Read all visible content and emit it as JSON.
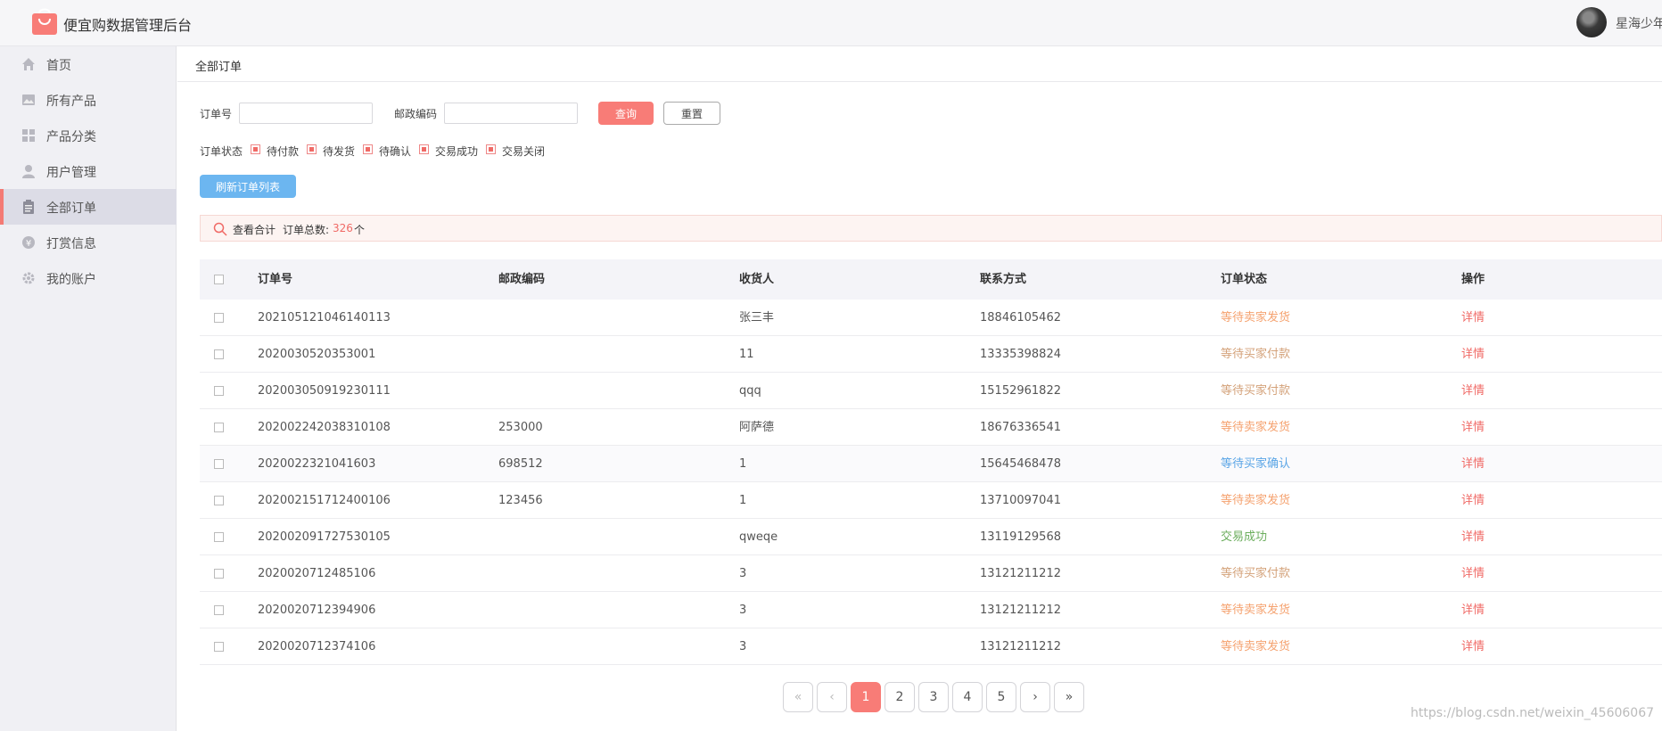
{
  "header": {
    "app_title": "便宜购数据管理后台",
    "user_name": "星海少年"
  },
  "sidebar": {
    "items": [
      {
        "label": "首页",
        "icon": "home-icon"
      },
      {
        "label": "所有产品",
        "icon": "image-icon"
      },
      {
        "label": "产品分类",
        "icon": "grid-icon"
      },
      {
        "label": "用户管理",
        "icon": "user-icon"
      },
      {
        "label": "全部订单",
        "icon": "clipboard-icon",
        "active": true
      },
      {
        "label": "打赏信息",
        "icon": "coin-icon"
      },
      {
        "label": "我的账户",
        "icon": "gear-icon"
      }
    ]
  },
  "breadcrumb": "全部订单",
  "filters": {
    "order_no_label": "订单号",
    "order_no_value": "",
    "postal_label": "邮政编码",
    "postal_value": "",
    "query_label": "查询",
    "reset_label": "重置",
    "status_label": "订单状态",
    "status_options": [
      "待付款",
      "待发货",
      "待确认",
      "交易成功",
      "交易关闭"
    ],
    "refresh_label": "刷新订单列表"
  },
  "summary": {
    "title": "查看合计",
    "total_label": "订单总数:",
    "total_count": "326",
    "unit": "个"
  },
  "table": {
    "headers": [
      "订单号",
      "邮政编码",
      "收货人",
      "联系方式",
      "订单状态",
      "操作"
    ],
    "rows": [
      {
        "order_no": "202105121046140113",
        "postal": "",
        "receiver": "张三丰",
        "phone": "18846105462",
        "status": "等待卖家发货",
        "action": "详情"
      },
      {
        "order_no": "2020030520353001",
        "postal": "",
        "receiver": "11",
        "phone": "13335398824",
        "status": "等待买家付款",
        "action": "详情"
      },
      {
        "order_no": "202003050919230111",
        "postal": "",
        "receiver": "qqq",
        "phone": "15152961822",
        "status": "等待买家付款",
        "action": "详情"
      },
      {
        "order_no": "202002242038310108",
        "postal": "253000",
        "receiver": "阿萨德",
        "phone": "18676336541",
        "status": "等待卖家发货",
        "action": "详情"
      },
      {
        "order_no": "2020022321041603",
        "postal": "698512",
        "receiver": "1",
        "phone": "15645468478",
        "status": "等待买家确认",
        "action": "详情"
      },
      {
        "order_no": "202002151712400106",
        "postal": "123456",
        "receiver": "1",
        "phone": "13710097041",
        "status": "等待卖家发货",
        "action": "详情"
      },
      {
        "order_no": "202002091727530105",
        "postal": "",
        "receiver": "qweqe",
        "phone": "13119129568",
        "status": "交易成功",
        "action": "详情"
      },
      {
        "order_no": "2020020712485106",
        "postal": "",
        "receiver": "3",
        "phone": "13121211212",
        "status": "等待买家付款",
        "action": "详情"
      },
      {
        "order_no": "2020020712394906",
        "postal": "",
        "receiver": "3",
        "phone": "13121211212",
        "status": "等待卖家发货",
        "action": "详情"
      },
      {
        "order_no": "2020020712374106",
        "postal": "",
        "receiver": "3",
        "phone": "13121211212",
        "status": "等待卖家发货",
        "action": "详情"
      }
    ]
  },
  "status_colors": {
    "等待卖家发货": "#f5a26f",
    "等待买家付款": "#d4a27a",
    "等待买家确认": "#5aa5e6",
    "交易成功": "#6cae5e"
  },
  "action_color": "#f06a66",
  "pagination": {
    "first": "«",
    "prev": "‹",
    "pages": [
      "1",
      "2",
      "3",
      "4",
      "5"
    ],
    "next": "›",
    "last": "»",
    "current": "1"
  },
  "watermark": "https://blog.csdn.net/weixin_45606067"
}
